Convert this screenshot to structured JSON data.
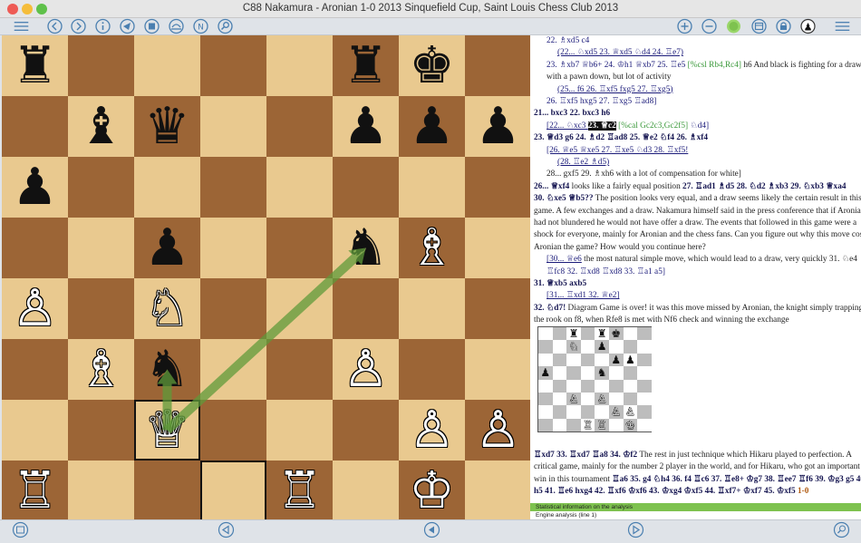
{
  "window": {
    "title": "C88  Nakamura - Aronian 1-0 2013 Sinquefield Cup, Saint Louis Chess Club 2013"
  },
  "toolbar": {
    "left_icons": [
      "menu-icon",
      "back-icon",
      "forward-icon",
      "info-icon",
      "send-icon",
      "stop-icon",
      "flip-icon",
      "n-icon",
      "magnify-icon"
    ],
    "right_icons": [
      "plus-icon",
      "minus-icon",
      "green-dot-icon",
      "window-icon",
      "lock-icon",
      "pawn-icon",
      "menu-icon"
    ]
  },
  "board": {
    "pieces": [
      {
        "square": "a8",
        "glyph": "♜",
        "color": "black"
      },
      {
        "square": "f8",
        "glyph": "♜",
        "color": "black"
      },
      {
        "square": "g8",
        "glyph": "♚",
        "color": "black"
      },
      {
        "square": "b7",
        "glyph": "♝",
        "color": "black"
      },
      {
        "square": "c7",
        "glyph": "♛",
        "color": "black"
      },
      {
        "square": "f7",
        "glyph": "♟",
        "color": "black"
      },
      {
        "square": "g7",
        "glyph": "♟",
        "color": "black"
      },
      {
        "square": "h7",
        "glyph": "♟",
        "color": "black"
      },
      {
        "square": "a6",
        "glyph": "♟",
        "color": "black"
      },
      {
        "square": "c5",
        "glyph": "♟",
        "color": "black"
      },
      {
        "square": "f5",
        "glyph": "♞",
        "color": "black"
      },
      {
        "square": "g5",
        "glyph": "♗",
        "color": "white"
      },
      {
        "square": "a4",
        "glyph": "♙",
        "color": "white"
      },
      {
        "square": "c4",
        "glyph": "♘",
        "color": "white"
      },
      {
        "square": "b3",
        "glyph": "♗",
        "color": "white"
      },
      {
        "square": "c3",
        "glyph": "♞",
        "color": "black"
      },
      {
        "square": "f3",
        "glyph": "♙",
        "color": "white"
      },
      {
        "square": "c2",
        "glyph": "♕",
        "color": "white"
      },
      {
        "square": "g2",
        "glyph": "♙",
        "color": "white"
      },
      {
        "square": "h2",
        "glyph": "♙",
        "color": "white"
      },
      {
        "square": "a1",
        "glyph": "♖",
        "color": "white"
      },
      {
        "square": "e1",
        "glyph": "♖",
        "color": "white"
      },
      {
        "square": "g1",
        "glyph": "♔",
        "color": "white"
      }
    ],
    "highlighted_squares": [
      "c2",
      "d1"
    ],
    "arrows": [
      {
        "from": "c2",
        "to": "f5",
        "color": "#5f9a3a"
      },
      {
        "from": "c2",
        "to": "c3",
        "color": "#5f9a3a"
      }
    ]
  },
  "notation": {
    "lines": [
      {
        "cls": "i1",
        "segments": [
          {
            "t": "22. ♗xd5 c4",
            "c": "v"
          }
        ]
      },
      {
        "cls": "i2",
        "segments": [
          {
            "t": "(22... ♘xd5 23. ♕xd5 ♘d4 24. ♖e7)",
            "c": "v u"
          }
        ]
      },
      {
        "cls": "i1",
        "segments": [
          {
            "t": "23. ♗xb7 ♕b6+ 24. ♔h1 ♕xb7 25. ♖e5 ",
            "c": "v"
          },
          {
            "t": "[%csl Rb4,Rc4]",
            "c": "g"
          },
          {
            "t": " h6 And black is fighting for a draw,",
            "c": ""
          }
        ]
      },
      {
        "cls": "i1",
        "segments": [
          {
            "t": "with a pawn down, but lot of activity",
            "c": ""
          }
        ]
      },
      {
        "cls": "i2",
        "segments": [
          {
            "t": "(25... f6 26. ♖xf5 fxg5 27. ♖xg5)",
            "c": "v u"
          }
        ]
      },
      {
        "cls": "i1",
        "segments": [
          {
            "t": "26. ♖xf5 hxg5 27. ♖xg5 ♖ad8]",
            "c": "v"
          }
        ]
      },
      {
        "cls": "",
        "segments": [
          {
            "t": "21... bxc3 22. bxc3 h6",
            "c": "b"
          }
        ]
      },
      {
        "cls": "i1",
        "segments": [
          {
            "t": "[22... ♘xc3 ",
            "c": "v u"
          },
          {
            "t": "23. ♕c2",
            "c": "sel"
          },
          {
            "t": " [%cal Gc2c3,Gc2f5]",
            "c": "g"
          },
          {
            "t": " ♘d4]",
            "c": "v"
          }
        ]
      },
      {
        "cls": "",
        "segments": [
          {
            "t": "23. ♕d3 g6 24. ♗d2 ♖ad8 25. ♕e2 ♘f4 26. ♗xf4",
            "c": "b"
          }
        ]
      },
      {
        "cls": "i1",
        "segments": [
          {
            "t": "[26. ♕e5 ♕xe5 27. ♖xe5 ♘d3 28. ♖xf5!",
            "c": "v u"
          }
        ]
      },
      {
        "cls": "i2",
        "segments": [
          {
            "t": "(28. ♖e2 ♗d5)",
            "c": "v u"
          }
        ]
      },
      {
        "cls": "i1",
        "segments": [
          {
            "t": "28... gxf5 29. ♗xh6 with a lot of compensation for white]",
            "c": ""
          }
        ]
      },
      {
        "cls": "",
        "segments": [
          {
            "t": "26... ♕xf4",
            "c": "b"
          },
          {
            "t": " looks like a fairly equal position ",
            "c": ""
          },
          {
            "t": "27. ♖ad1 ♗d5 28. ♘d2 ♗xb3 29. ♘xb3 ♕xa4",
            "c": "b"
          }
        ]
      },
      {
        "cls": "",
        "segments": [
          {
            "t": "30. ♘xe5 ♕b5??",
            "c": "b"
          },
          {
            "t": " The position looks very equal, and a draw seems likely the certain result in this",
            "c": ""
          }
        ]
      },
      {
        "cls": "",
        "segments": [
          {
            "t": "game. A few exchanges and a draw. Nakamura himself said in the press conference that if Aronian",
            "c": ""
          }
        ]
      },
      {
        "cls": "",
        "segments": [
          {
            "t": "had not blundered he would not have offer a draw. The events that followed in this game were a",
            "c": ""
          }
        ]
      },
      {
        "cls": "",
        "segments": [
          {
            "t": "shock for everyone, mainly for Aronian and the chess fans. Can you figure out why this move cost",
            "c": ""
          }
        ]
      },
      {
        "cls": "",
        "segments": [
          {
            "t": "Aronian the game? How would you continue here?",
            "c": ""
          }
        ]
      },
      {
        "cls": "i1",
        "segments": [
          {
            "t": "[30... ♕e6",
            "c": "v u"
          },
          {
            "t": " the most natural simple move, which would lead to a draw, very quickly 31. ♘e4",
            "c": ""
          }
        ]
      },
      {
        "cls": "i1",
        "segments": [
          {
            "t": "♖fc8 32. ♖xd8 ♖xd8 33. ♖a1 a5]",
            "c": "v"
          }
        ]
      },
      {
        "cls": "",
        "segments": [
          {
            "t": "31. ♕xb5 axb5",
            "c": "b"
          }
        ]
      },
      {
        "cls": "i1",
        "segments": [
          {
            "t": "[31... ♖xd1 32. ♕e2]",
            "c": "v u"
          }
        ]
      },
      {
        "cls": "",
        "segments": [
          {
            "t": "32. ♘d7!",
            "c": "b"
          },
          {
            "t": " Diagram Game is over! it was this move missed by Aronian, the knight simply trapping",
            "c": ""
          }
        ]
      },
      {
        "cls": "",
        "segments": [
          {
            "t": "the rook on f8, when Rfe8 is met with Nf6 check and winning the exchange",
            "c": ""
          }
        ]
      }
    ],
    "ending_lines": [
      {
        "segments": [
          {
            "t": "♖xd7 33. ♖xd7 ♖a8 34. ♔f2",
            "c": "b"
          },
          {
            "t": " The rest in just technique which Hikaru played to perfection. A",
            "c": ""
          }
        ]
      },
      {
        "segments": [
          {
            "t": "critical game, mainly for the number 2 player in the world, and for Hikaru, who got an important",
            "c": ""
          }
        ]
      },
      {
        "segments": [
          {
            "t": "win in this tournament ",
            "c": ""
          },
          {
            "t": "♖a6 35. g4 ♘h4 36. f4 ♖c6 37. ♖e8+ ♔g7 38. ♖ee7 ♖f6 39. ♔g3 g5 40. f5",
            "c": "b"
          }
        ]
      },
      {
        "segments": [
          {
            "t": "h5 41. ♖e6 hxg4 42. ♖xf6 ♔xf6 43. ♔xg4 ♔xf5 44. ♖xf7+ ♔xf7 45. ♔xf5 ",
            "c": "b"
          },
          {
            "t": "1-0",
            "c": "or"
          }
        ]
      }
    ],
    "mini_board": {
      "pieces": [
        {
          "square": "c8",
          "glyph": "♜",
          "color": "black"
        },
        {
          "square": "e8",
          "glyph": "♜",
          "color": "black"
        },
        {
          "square": "f8",
          "glyph": "♚",
          "color": "black"
        },
        {
          "square": "c7",
          "glyph": "♘",
          "color": "white"
        },
        {
          "square": "e7",
          "glyph": "♟",
          "color": "black"
        },
        {
          "square": "f6",
          "glyph": "♟",
          "color": "black"
        },
        {
          "square": "g6",
          "glyph": "♟",
          "color": "black"
        },
        {
          "square": "a5",
          "glyph": "♟",
          "color": "black"
        },
        {
          "square": "e5",
          "glyph": "♞",
          "color": "black"
        },
        {
          "square": "c3",
          "glyph": "♙",
          "color": "white"
        },
        {
          "square": "e3",
          "glyph": "♙",
          "color": "white"
        },
        {
          "square": "f2",
          "glyph": "♙",
          "color": "white"
        },
        {
          "square": "g2",
          "glyph": "♙",
          "color": "white"
        },
        {
          "square": "d1",
          "glyph": "♖",
          "color": "white"
        },
        {
          "square": "e1",
          "glyph": "♖",
          "color": "white"
        },
        {
          "square": "g1",
          "glyph": "♔",
          "color": "white"
        }
      ]
    }
  },
  "status": {
    "stats": "Statistical information on the analysis",
    "engine": "Engine analysis (line 1)"
  },
  "bottombar": {
    "icons": [
      "db-icon",
      "prev-icon",
      "first-icon",
      "play-icon",
      "search-icon"
    ]
  },
  "colors": {
    "light_square": "#e9c98f",
    "dark_square": "#9c6536",
    "arrow": "#5f9a3a",
    "status_green": "#7ec24f"
  }
}
